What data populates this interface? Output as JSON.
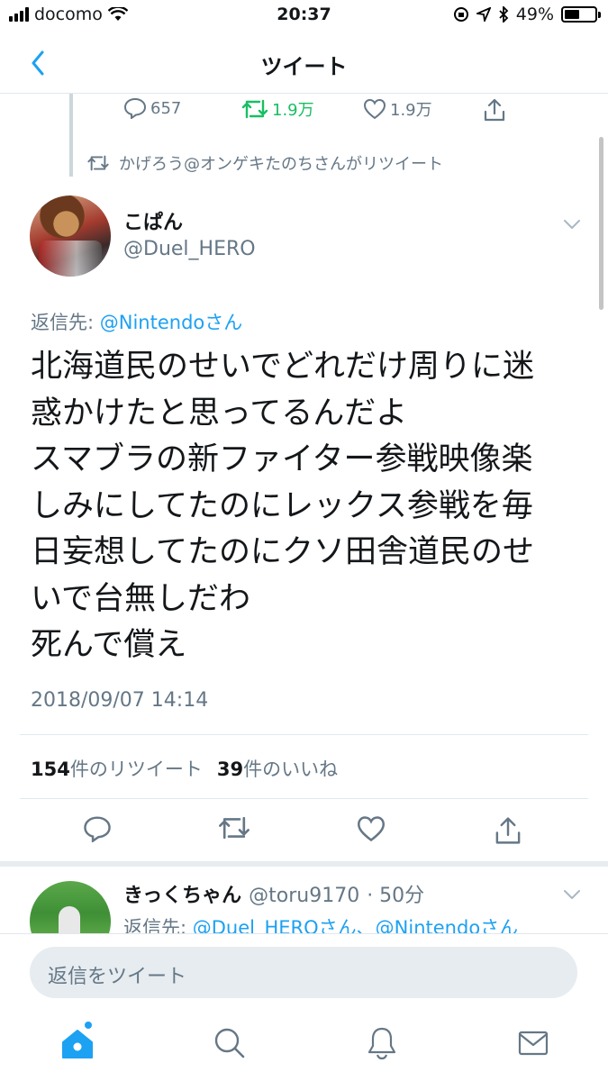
{
  "status_bar": {
    "carrier": "docomo",
    "time": "20:37",
    "battery": "49%",
    "battery_level": 0.49
  },
  "nav": {
    "title": "ツイート"
  },
  "prev_tweet": {
    "replies": "657",
    "retweets": "1.9万",
    "likes": "1.9万"
  },
  "retweet_context": {
    "text": "かげろう@オンゲキたのちさんがリツイート"
  },
  "tweet": {
    "display_name": "こぱん",
    "handle": "@Duel_HERO",
    "reply_to_label": "返信先: ",
    "reply_to_mention": "@Nintendoさん",
    "text": "北海道民のせいでどれだけ周りに迷\n惑かけたと思ってるんだよ\nスマブラの新ファイター参戦映像楽\nしみにしてたのにレックス参戦を毎\n日妄想してたのにクソ田舎道民のせ\nいで台無しだわ\n死んで償え",
    "date": "2018/09/07 14:14",
    "retweet_count": "154",
    "retweet_label": "件のリツイート",
    "like_count": "39",
    "like_label": "件のいいね"
  },
  "reply": {
    "display_name": "きっくちゃん",
    "handle": "@toru9170",
    "time": "· 50分",
    "reply_to_label": "返信先: ",
    "reply_to_mentions": "@Duel_HEROさん、@Nintendoさん"
  },
  "compose": {
    "placeholder": "返信をツイート"
  },
  "colors": {
    "accent": "#1da1f2",
    "retweet_green": "#17bf63",
    "secondary_text": "#657786"
  }
}
